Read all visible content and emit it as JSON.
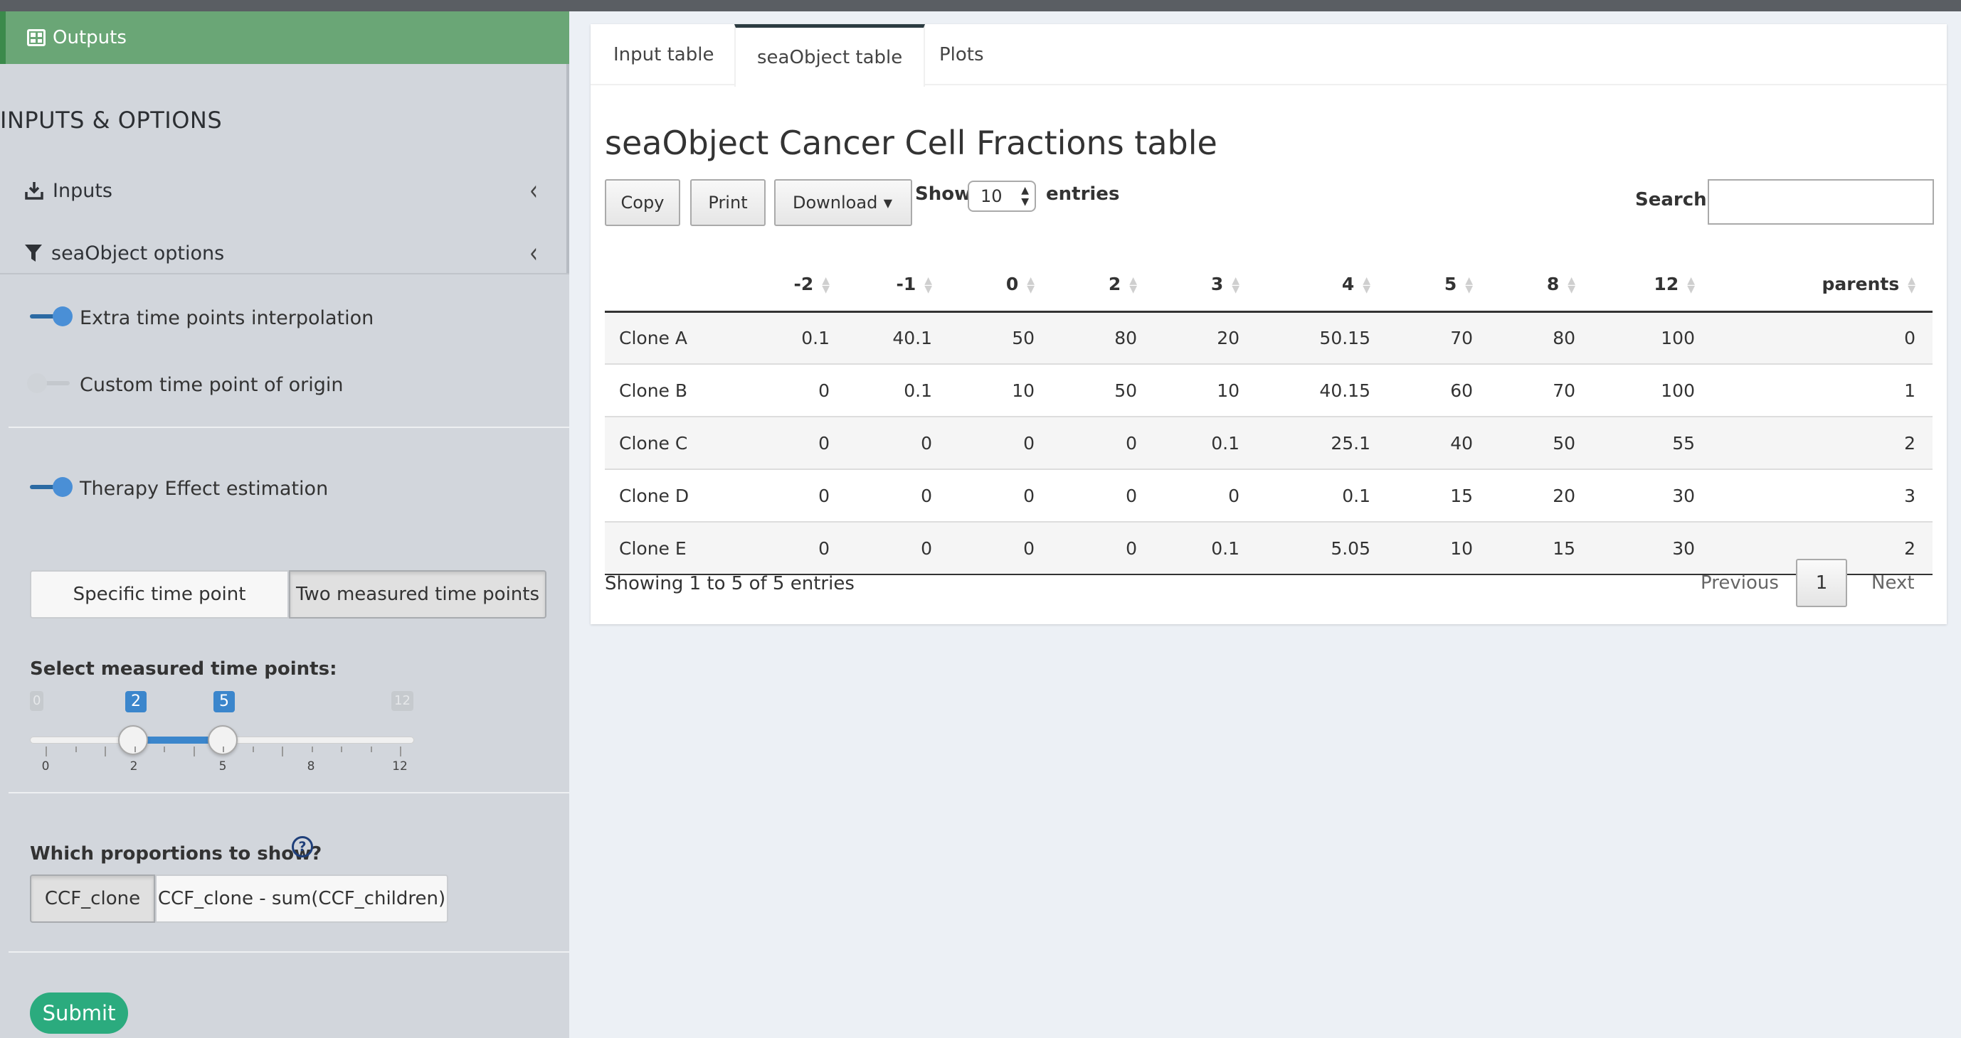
{
  "sidebar": {
    "outputs_label": "Outputs",
    "section_title": "INPUTS & OPTIONS",
    "inputs_label": "Inputs",
    "seaobject_options_label": "seaObject options",
    "extra_time_label": "Extra time points interpolation",
    "custom_origin_label": "Custom time point of origin",
    "therapy_label": "Therapy Effect estimation",
    "time_mode": {
      "options": [
        "Specific time point",
        "Two measured time points"
      ],
      "selected": "Two measured time points"
    },
    "slider": {
      "label": "Select measured time points:",
      "min": "0",
      "max": "12",
      "from": "2",
      "to": "5",
      "ticks": [
        "0",
        "2",
        "5",
        "8",
        "12"
      ]
    },
    "proportions": {
      "label": "Which proportions to show?",
      "help_glyph": "?",
      "options": [
        "CCF_clone",
        "CCF_clone - sum(CCF_children)"
      ],
      "selected": "CCF_clone"
    },
    "submit_label": "Submit",
    "toggles": {
      "extra_time": true,
      "custom_origin": false,
      "therapy": true
    }
  },
  "main": {
    "tabs": [
      "Input table",
      "seaObject table",
      "Plots"
    ],
    "active_tab": "seaObject table",
    "title": "seaObject Cancer Cell Fractions table",
    "buttons": {
      "copy": "Copy",
      "print": "Print",
      "download": "Download"
    },
    "length": {
      "show": "Show",
      "value": "10",
      "entries": "entries"
    },
    "search_label": "Search:",
    "table": {
      "columns": [
        "",
        "-2",
        "-1",
        "0",
        "2",
        "3",
        "4",
        "5",
        "8",
        "12",
        "parents"
      ],
      "rows": [
        [
          "Clone A",
          "0.1",
          "40.1",
          "50",
          "80",
          "20",
          "50.15",
          "70",
          "80",
          "100",
          "0"
        ],
        [
          "Clone B",
          "0",
          "0.1",
          "10",
          "50",
          "10",
          "40.15",
          "60",
          "70",
          "100",
          "1"
        ],
        [
          "Clone C",
          "0",
          "0",
          "0",
          "0",
          "0.1",
          "25.1",
          "40",
          "50",
          "55",
          "2"
        ],
        [
          "Clone D",
          "0",
          "0",
          "0",
          "0",
          "0",
          "0.1",
          "15",
          "20",
          "30",
          "3"
        ],
        [
          "Clone E",
          "0",
          "0",
          "0",
          "0",
          "0.1",
          "5.05",
          "10",
          "15",
          "30",
          "2"
        ]
      ]
    },
    "info": "Showing 1 to 5 of 5 entries",
    "pager": {
      "previous": "Previous",
      "page": "1",
      "next": "Next"
    }
  },
  "colors": {
    "sidebar_bg": "#d2d6dc",
    "outputs_green": "#6aa676",
    "accent_blue": "#3b86cc",
    "submit_green": "#2bab7e"
  }
}
